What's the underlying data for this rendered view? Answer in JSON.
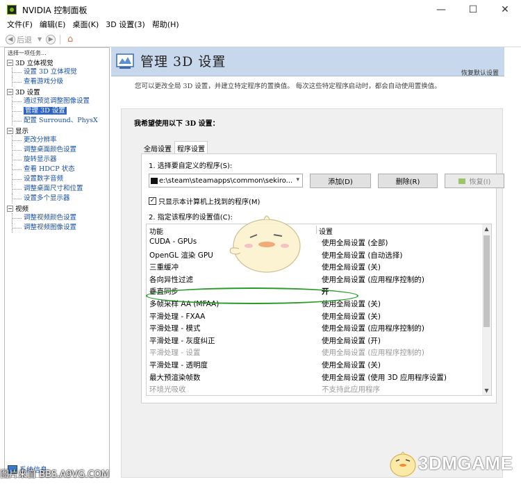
{
  "window": {
    "title": "NVIDIA 控制面板",
    "minimize_glyph": "—",
    "maximize_glyph": "☐",
    "close_glyph": "✕"
  },
  "menu": [
    "文件(F)",
    "编辑(E)",
    "桌面(K)",
    "3D 设置(3)",
    "帮助(H)"
  ],
  "toolbar": {
    "back_label": "后退",
    "back_icon": "back-arrow-icon",
    "forward_icon": "forward-arrow-icon",
    "home_icon": "home-icon"
  },
  "sidebar": {
    "task_label": "选择一项任务...",
    "categories": [
      {
        "label": "3D 立体视觉",
        "items": [
          "设置 3D 立体视觉",
          "查看游戏分级"
        ]
      },
      {
        "label": "3D 设置",
        "items": [
          "通过预览调整图像设置",
          "管理 3D 设置",
          "配置 Surround、PhysX"
        ],
        "selected_index": 1
      },
      {
        "label": "显示",
        "items": [
          "更改分辨率",
          "调整桌面颜色设置",
          "旋转显示器",
          "查看 HDCP 状态",
          "设置数字音频",
          "调整桌面尺寸和位置",
          "设置多个显示器"
        ]
      },
      {
        "label": "视频",
        "items": [
          "调整视频颜色设置",
          "调整视频图像设置"
        ]
      }
    ],
    "system_info": "系统信息"
  },
  "main": {
    "title": "管理 3D 设置",
    "restore_defaults": "恢复默认设置",
    "description": "您可以更改全局 3D 设置，并建立特定程序的置换值。 每次这些特定程序启动时，都会自动使用置换值。",
    "panel_heading": "我希望使用以下 3D 设置：",
    "tabs": [
      "全局设置",
      "程序设置"
    ],
    "active_tab": 1,
    "select_program_label": "1. 选择要自定义的程序(S):",
    "program_path": "e:\\steam\\steamapps\\common\\sekiro...",
    "add_button": "添加(D)",
    "remove_button": "删除(R)",
    "restore_button": "恢复(I)",
    "checkbox_label": "只显示本计算机上找到的程序(M)",
    "checkbox_checked": true,
    "specify_settings_label": "2. 指定该程序的设置值(C):",
    "table": {
      "columns": [
        "功能",
        "设置"
      ],
      "rows": [
        {
          "feature": "CUDA - GPUs",
          "value": "使用全局设置 (全部)"
        },
        {
          "feature": "OpenGL 渲染 GPU",
          "value": "使用全局设置 (自动选择)"
        },
        {
          "feature": "三重缓冲",
          "value": "使用全局设置 (关)"
        },
        {
          "feature": "各向异性过滤",
          "value": "使用全局设置 (应用程序控制的)"
        },
        {
          "feature": "垂直同步",
          "value": "开",
          "bold": true
        },
        {
          "feature": "多帧采样 AA (MFAA)",
          "value": "使用全局设置 (关)"
        },
        {
          "feature": "平滑处理 - FXAA",
          "value": "使用全局设置 (关)"
        },
        {
          "feature": "平滑处理 - 模式",
          "value": "使用全局设置 (应用程序控制的)"
        },
        {
          "feature": "平滑处理 - 灰度纠正",
          "value": "使用全局设置 (开)"
        },
        {
          "feature": "平滑处理 - 设置",
          "value": "使用全局设置 (应用程序控制的)",
          "dim": true
        },
        {
          "feature": "平滑处理 - 透明度",
          "value": "使用全局设置 (关)"
        },
        {
          "feature": "最大预渲染帧数",
          "value": "使用全局设置 (使用 3D 应用程序设置)"
        },
        {
          "feature": "环境光吸收",
          "value": "不支持此应用程序",
          "dim": true
        }
      ]
    }
  },
  "watermarks": {
    "bottom_left": "图片来自 BBS.A9VG.COM",
    "bottom_right": "3DMGAME"
  },
  "colors": {
    "header_band": "#c8d8ec",
    "selection": "#2f65c9",
    "link_blue": "#1a4fa0",
    "annotation_green": "#2a9a2a",
    "nvidia_green": "#76b900"
  }
}
